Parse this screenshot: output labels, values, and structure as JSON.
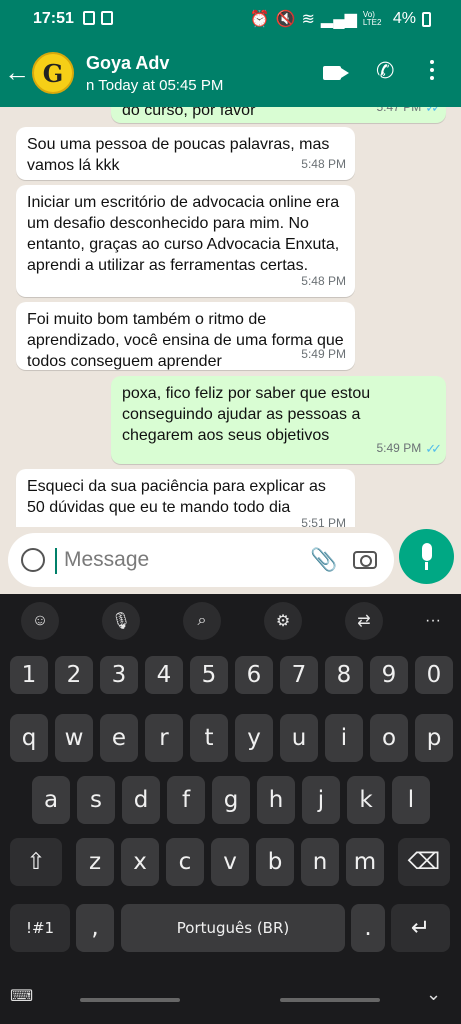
{
  "status": {
    "time": "17:51",
    "battery": "4%",
    "network": "Vo) LTE2"
  },
  "header": {
    "name": "Goya Adv",
    "avatar_letter": "G",
    "last_seen": "n Today at 05:45 PM"
  },
  "messages": [
    {
      "dir": "out",
      "text": "do curso, por favor",
      "time": "5:47 PM"
    },
    {
      "dir": "in",
      "text": "Sou uma pessoa de poucas palavras, mas vamos lá kkk",
      "time": "5:48 PM"
    },
    {
      "dir": "in",
      "text": "Iniciar um escritório de advocacia online era um desafio desconhecido para mim. No entanto, graças ao curso Advocacia Enxuta, aprendi a utilizar as ferramentas certas.",
      "time": "5:48 PM"
    },
    {
      "dir": "in",
      "text": "Foi muito bom também o ritmo de aprendizado, você ensina de uma forma que todos conseguem aprender",
      "time": "5:49 PM"
    },
    {
      "dir": "out",
      "text": "poxa, fico feliz por saber que estou conseguindo ajudar as pessoas a chegarem aos seus objetivos",
      "time": "5:49 PM"
    },
    {
      "dir": "in",
      "text": "Esqueci da sua paciência para explicar as 50 dúvidas que eu te mando todo dia",
      "time": "5:51 PM"
    }
  ],
  "composer": {
    "placeholder": "Message"
  },
  "keyboard": {
    "row_numbers": [
      "1",
      "2",
      "3",
      "4",
      "5",
      "6",
      "7",
      "8",
      "9",
      "0"
    ],
    "row_1": [
      "q",
      "w",
      "e",
      "r",
      "t",
      "y",
      "u",
      "i",
      "o",
      "p"
    ],
    "row_2": [
      "a",
      "s",
      "d",
      "f",
      "g",
      "h",
      "j",
      "k",
      "l"
    ],
    "row_3": [
      "z",
      "x",
      "c",
      "v",
      "b",
      "n",
      "m"
    ],
    "symbols_label": "!#1",
    "comma": ",",
    "space_label": "Português (BR)",
    "period": "."
  },
  "colors": {
    "header": "#008069",
    "outgoing": "#d9fdd3",
    "send": "#00a884",
    "ticks": "#53bdeb"
  }
}
